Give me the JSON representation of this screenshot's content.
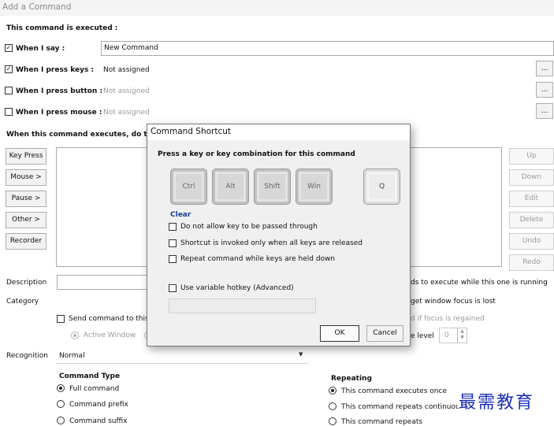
{
  "window": {
    "title": "Add a Command"
  },
  "triggers": {
    "header": "This command is executed :",
    "say_label": "When I say :",
    "say_value": "New Command",
    "keys_label": "When I press keys :",
    "keys_value": "Not assigned",
    "button_label": "When I press button :",
    "button_value": "Not assigned",
    "mouse_label": "When I press mouse :",
    "mouse_value": "Not assigned",
    "dots": "..."
  },
  "actions": {
    "header": "When this command executes, do the f",
    "left_buttons": [
      "Key Press",
      "Mouse >",
      "Pause >",
      "Other >",
      "Recorder"
    ],
    "right_buttons": [
      "Up",
      "Down",
      "Edit",
      "Delete",
      "Undo",
      "Redo"
    ]
  },
  "fields": {
    "description_label": "Description",
    "category_label": "Category",
    "send_label": "Send command to this",
    "active_window_label": "Active Window",
    "allow_other_partial": "ds to execute while this one is running",
    "stop_focus_partial": "get window focus is lost",
    "resume_focus_partial": "d if focus is regained",
    "level_partial": "e level",
    "level_value": "0",
    "recognition_label": "Recognition",
    "recognition_value": "Normal"
  },
  "command_type": {
    "header": "Command Type",
    "options": [
      "Full command",
      "Command prefix",
      "Command suffix"
    ],
    "selected": "Full command"
  },
  "repeating": {
    "header": "Repeating",
    "options": [
      "This command executes once",
      "This command repeats continuou",
      "This command repeats"
    ],
    "selected": "This command executes once"
  },
  "dialog": {
    "title": "Command Shortcut",
    "prompt": "Press a key or key combination for this command",
    "keys": [
      "Ctrl",
      "Alt",
      "Shift",
      "Win",
      "Q"
    ],
    "clear": "Clear",
    "opt_pass_through": "Do not allow key to be passed through",
    "opt_released": "Shortcut is invoked only when all keys are released",
    "opt_repeat": "Repeat command while keys are held down",
    "opt_variable": "Use variable hotkey (Advanced)",
    "ok": "OK",
    "cancel": "Cancel"
  },
  "watermark": "最需教育",
  "colors": {
    "link": "#1a3f9a",
    "watermark": "#1b2fb5"
  }
}
